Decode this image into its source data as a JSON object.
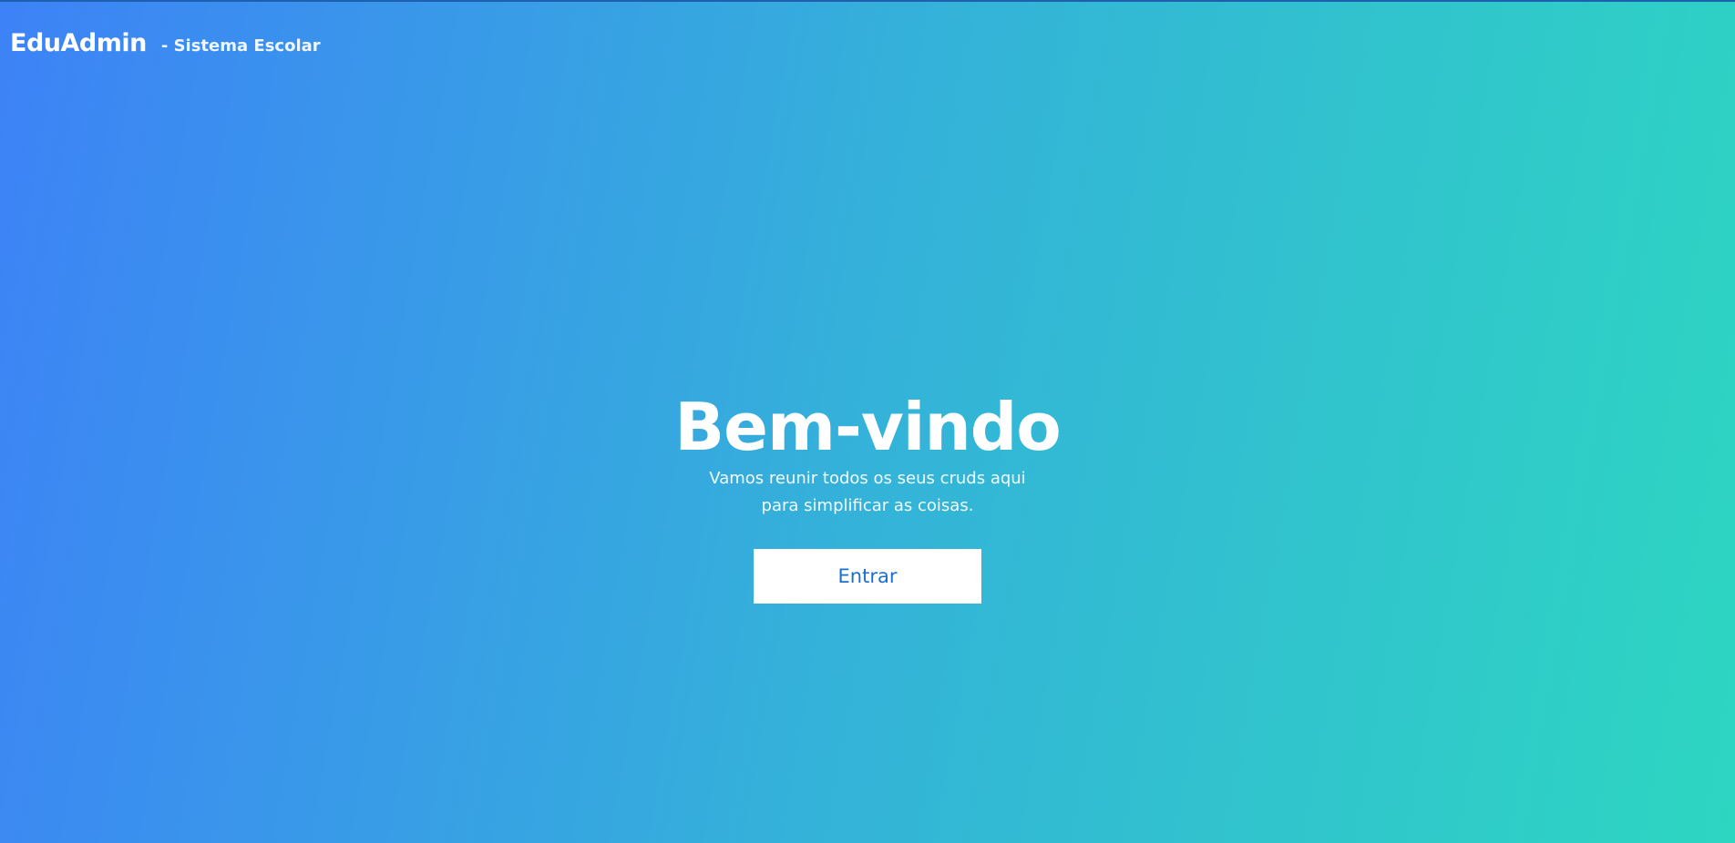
{
  "header": {
    "brand": "EduAdmin",
    "tagline": "- Sistema Escolar"
  },
  "hero": {
    "title": "Bem-vindo",
    "subtitle": "Vamos reunir todos os seus cruds aqui para simplificar as coisas.",
    "button_label": "Entrar"
  },
  "colors": {
    "gradient_start": "#3d82f7",
    "gradient_end": "#2dd6c1",
    "button_text": "#1a6fd0"
  }
}
